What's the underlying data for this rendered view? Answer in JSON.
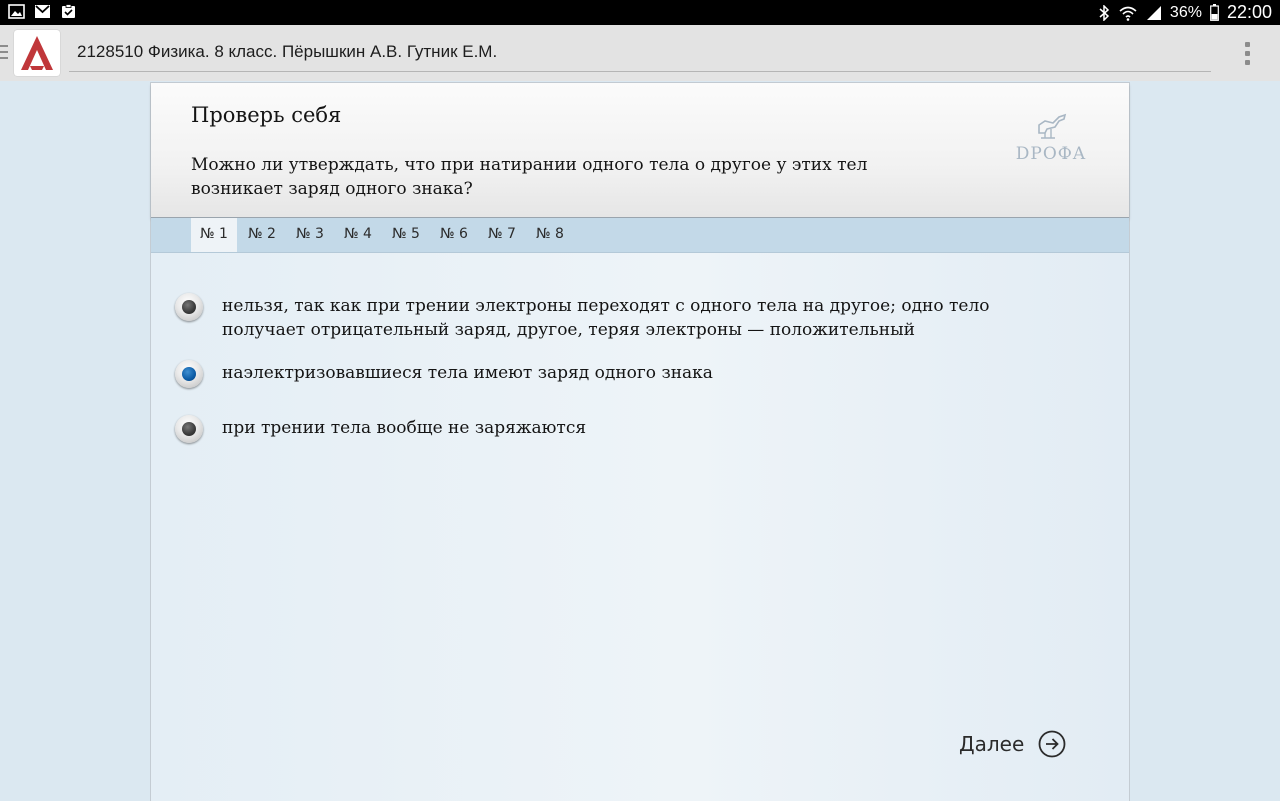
{
  "status_bar": {
    "left_icons": [
      "gallery-icon",
      "gmail-icon",
      "clipboard-check-icon"
    ],
    "right_icons": [
      "bluetooth-icon",
      "wifi-icon",
      "signal-icon",
      "battery-icon"
    ],
    "battery": "36%",
    "time": "22:00"
  },
  "app_bar": {
    "title": "2128510 Физика. 8 класс. Пёрышкин А.В. Гутник Е.М.",
    "logo_color": "#c0373a"
  },
  "card": {
    "heading": "Проверь себя",
    "question": "Можно ли утверждать, что при натирании одного тела о другое у этих тел возникает заряд одного знака?",
    "brand": "DPOФA"
  },
  "tabs": {
    "items": [
      "№ 1",
      "№ 2",
      "№ 3",
      "№ 4",
      "№ 5",
      "№ 6",
      "№ 7",
      "№ 8"
    ],
    "active_index": 0
  },
  "options": {
    "items": [
      "нельзя, так как при трении электроны переходят с одного тела на другое; одно тело получает отрицательный заряд, другое, теряя электроны — положительный",
      "наэлектризовавшиеся тела имеют заряд одного знака",
      "при трении тела вообще не заряжаются"
    ],
    "selected_index": 1
  },
  "next": {
    "label": "Далее"
  },
  "colors": {
    "selected_radio": "#0c5ca6",
    "tab_bar": "#c3d9e8",
    "background": "#dbe8f1"
  }
}
